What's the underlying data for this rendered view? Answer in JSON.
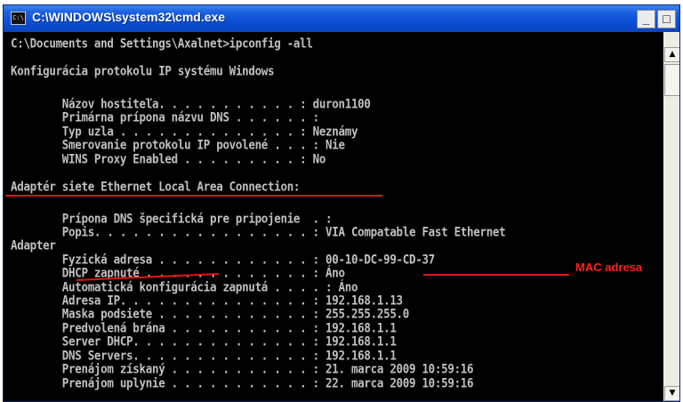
{
  "window": {
    "title": "C:\\WINDOWS\\system32\\cmd.exe",
    "icon_text": "C:\\",
    "minimize": "_",
    "maximize": "□"
  },
  "console": {
    "prompt": "C:\\Documents and Settings\\Axalnet>ipconfig -all",
    "header": "Konfigurácia protokolu IP systému Windows",
    "host": [
      "        Názov hostiteľa. . . . . . . . . . . : duron1100",
      "        Primárna prípona názvu DNS . . . . . . :",
      "        Typ uzla . . . . . . . . . . . . . . : Neznámy",
      "        Smerovanie protokolu IP povolené . . . : Nie",
      "        WINS Proxy Enabled . . . . . . . . . : No"
    ],
    "adapter_title": "Adaptér siete Ethernet Local Area Connection:",
    "adapter_pre": [
      "        Prípona DNS špecifická pre pripojenie  . :",
      "        Popis. . . . . . . . . . . . . . . . . : VIA Compatable Fast Ethernet",
      "Adapter"
    ],
    "details": [
      "        Fyzická adresa . . . . . . . . . . . . : 00-10-DC-99-CD-37",
      "        DHCP zapnuté . . . . . . . . . . . . . : Áno",
      "        Automatická konfigurácia zapnutá . . . . : Áno",
      "        Adresa IP. . . . . . . . . . . . . . . : 192.168.1.13",
      "        Maska podsiete . . . . . . . . . . . . : 255.255.255.0",
      "        Predvolená brána . . . . . . . . . . . : 192.168.1.1",
      "        Server DHCP. . . . . . . . . . . . . . : 192.168.1.1",
      "        DNS Servers. . . . . . . . . . . . . . : 192.168.1.1",
      "        Prenájom získaný . . . . . . . . . . . : 21. marca 2009 10:59:16",
      "        Prenájom uplynie . . . . . . . . . . . : 22. marca 2009 10:59:16"
    ]
  },
  "annotation": {
    "mac_label": "MAC adresa",
    "color": "#e8140e"
  },
  "scrollbar": {
    "up": "▲",
    "down": "▼"
  },
  "colors": {
    "console_bg": "#000000",
    "console_text": "#c0c0c0",
    "titlebar": "#0b4fd4"
  }
}
